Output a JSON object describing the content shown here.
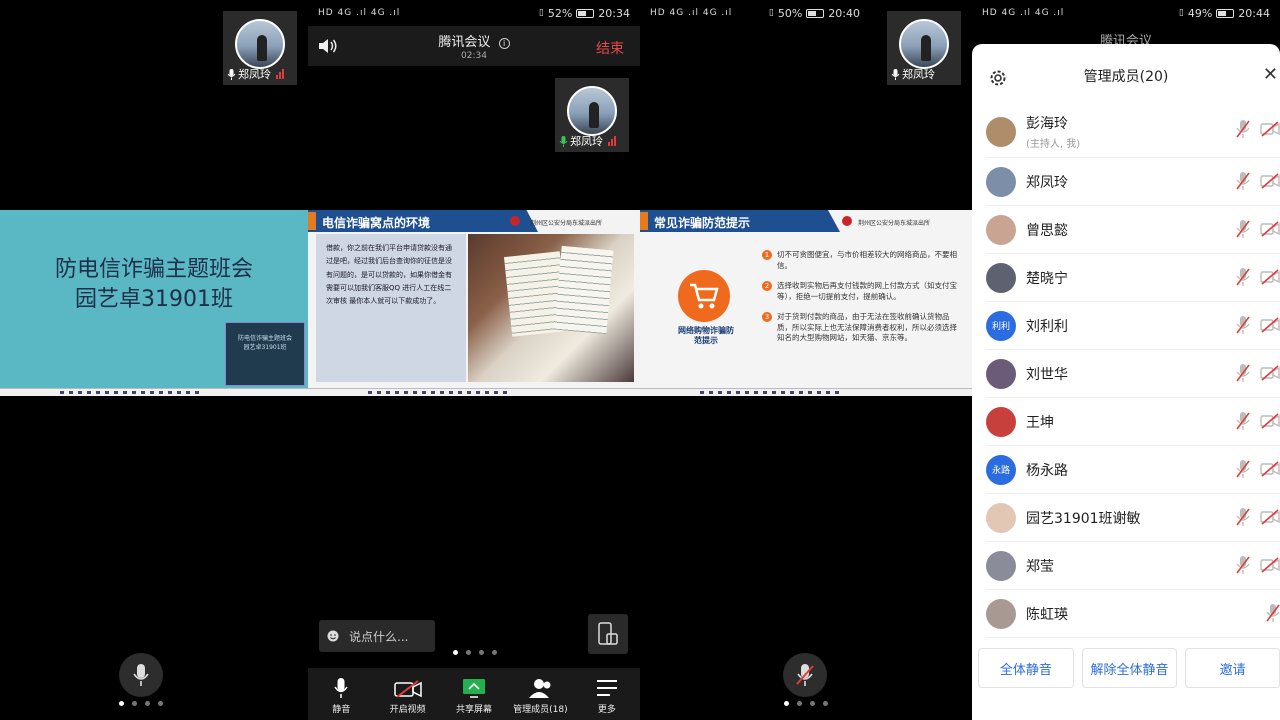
{
  "panel1": {
    "thumb_name": "郑凤玲",
    "slide": {
      "title_line1": "防电信诈骗主题班会",
      "title_line2": "园艺卓31901班",
      "inner_line1": "防电信诈骗主题班会",
      "inner_line2": "园艺卓31901班"
    }
  },
  "panel2": {
    "status": {
      "signal": "HD 4G .ıl 4G .ıl",
      "battery": "52%",
      "time": "20:34"
    },
    "meeting_title": "腾讯会议",
    "timer": "02:34",
    "end_label": "结束",
    "thumb_name": "郑凤玲",
    "slide": {
      "header": "电信诈骗窝点的环境",
      "police_label": "荆州区公安分局东城派出所",
      "doc_text": "借款，你之前在我们平台申请贷款没有通过是吧，经过我们后台查询你的征信是没有问题的，是可以贷款的，如果你借金有需要可以加我们客服QQ 进行人工在线二次审核 最你本人就可以下款成功了。"
    },
    "chat_placeholder": "说点什么...",
    "toolbar": [
      {
        "label": "静音",
        "icon": "mic-icon"
      },
      {
        "label": "开启视频",
        "icon": "video-off-icon"
      },
      {
        "label": "共享屏幕",
        "icon": "share-screen-icon"
      },
      {
        "label": "管理成员(18)",
        "icon": "members-icon"
      },
      {
        "label": "更多",
        "icon": "more-icon"
      }
    ]
  },
  "panel3": {
    "status": {
      "signal": "HD 4G .ıl 4G .ıl",
      "battery": "50%",
      "time": "20:40"
    },
    "thumb_name": "郑凤玲",
    "slide": {
      "header": "常见诈骗防范提示",
      "police_label": "荆州区公安分局东城派出所",
      "icon_caption": "网络购物诈骗防范提示",
      "tips": [
        "切不可贪图便宜，与市价相差较大的网络商品，不要相信。",
        "选择收到实物后再支付钱款的网上付款方式（如支付宝等），拒绝一切提前支付，提前确认。",
        "对于货到付款的商品，由于无法在签收前确认货物品质，所以实际上也无法保障消费者权利，所以必须选择知名的大型购物网站，如天猫、京东等。"
      ]
    }
  },
  "panel4": {
    "status": {
      "signal": "HD 4G .ıl 4G .ıl",
      "battery": "49%",
      "time": "20:44"
    },
    "meeting_title": "腾讯会议",
    "drawer_title": "管理成员(20)",
    "members": [
      {
        "name": "彭海玲",
        "sub": "(主持人, 我)",
        "avatar_color": "#b08d6a",
        "avatar_text": ""
      },
      {
        "name": "郑凤玲",
        "sub": "",
        "avatar_color": "#7d8fa8",
        "avatar_text": ""
      },
      {
        "name": "曾思懿",
        "sub": "",
        "avatar_color": "#c9a493",
        "avatar_text": ""
      },
      {
        "name": "楚晓宁",
        "sub": "",
        "avatar_color": "#5e6270",
        "avatar_text": ""
      },
      {
        "name": "刘利利",
        "sub": "",
        "avatar_color": "#2b6de0",
        "avatar_text": "利利"
      },
      {
        "name": "刘世华",
        "sub": "",
        "avatar_color": "#6b5a78",
        "avatar_text": ""
      },
      {
        "name": "王坤",
        "sub": "",
        "avatar_color": "#c8403c",
        "avatar_text": ""
      },
      {
        "name": "杨永路",
        "sub": "",
        "avatar_color": "#2b6de0",
        "avatar_text": "永路"
      },
      {
        "name": "园艺31901班谢敏",
        "sub": "",
        "avatar_color": "#e2c7b4",
        "avatar_text": ""
      },
      {
        "name": "郑莹",
        "sub": "",
        "avatar_color": "#8a8d99",
        "avatar_text": ""
      },
      {
        "name": "陈虹瑛",
        "sub": "",
        "avatar_color": "#a89a92",
        "avatar_text": ""
      }
    ],
    "buttons": {
      "mute_all": "全体静音",
      "unmute_all": "解除全体静音",
      "invite": "邀请"
    }
  }
}
